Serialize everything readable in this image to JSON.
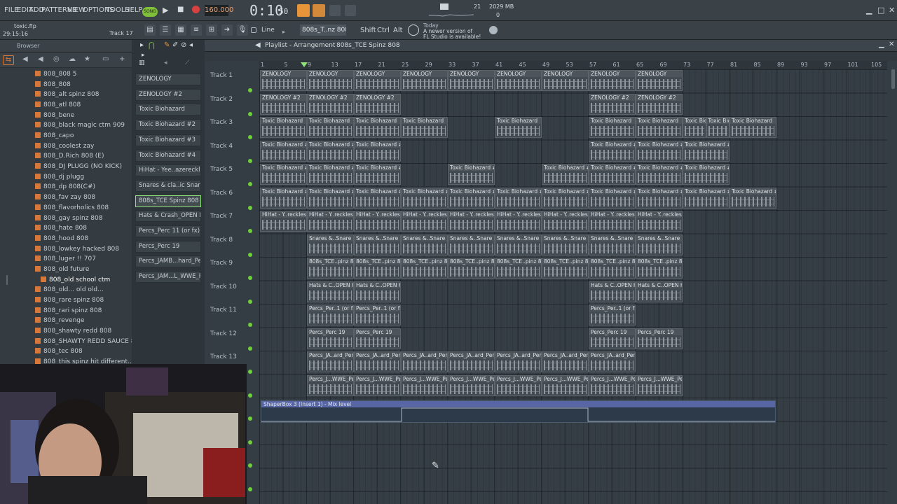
{
  "menu": [
    "FILE",
    "EDIT",
    "ADD",
    "PATTERNS",
    "VIEW",
    "OPTIONS",
    "TOOLS",
    "HELP"
  ],
  "transport": {
    "mode": "SONG",
    "tempo": "160.000",
    "time": "0:10",
    "time_frac": "50",
    "cpu": "21",
    "ram": "2029 MB",
    "ram_sub": "0"
  },
  "project": {
    "file": "toxic.flp",
    "elapsed": "29:15:16",
    "track_hint": "Track 17"
  },
  "toolbar2": {
    "snap": "Line",
    "pattern": "808s_T..nz 808",
    "shift": "Shift",
    "ctrl": "Ctrl",
    "alt": "Alt"
  },
  "news": {
    "when": "Today",
    "line1": "A newer version of",
    "line2": "FL Studio is available!"
  },
  "browser": {
    "title": "Browser",
    "items": [
      "808_808 5",
      "808_808",
      "808_alt spinz 808",
      "808_atl 808",
      "808_bene",
      "808_black magic ctm 909",
      "808_capo",
      "808_coolest zay",
      "808_D.Rich 808 (E)",
      "808_DJ PLUGG (NO KICK)",
      "808_dj plugg",
      "808_dp 808(C#)",
      "808_fav zay 808",
      "808_flavorholics 808",
      "808_gay spinz 808",
      "808_hate 808",
      "808_hood 808",
      "808_lowkey hacked 808",
      "808_luger !! 707",
      "808_old future",
      "808_old school ctm",
      "808_old... old old...",
      "808_rare spinz 808",
      "808_rari spinz 808",
      "808_revenge",
      "808_shawty redd 808",
      "808_SHAWTY REDD SAUCE 808",
      "808_tec 808",
      "808_this spinz hit different..."
    ]
  },
  "channels": [
    "ZENOLOGY",
    "ZENOLOGY #2",
    "Toxic Biohazard",
    "Toxic Biohazard #2",
    "Toxic Biohazard #3",
    "Toxic Biohazard #4",
    "HiHat - Yee..azereckless",
    "Snares & cla..ic Snare (8)",
    "808s_TCE Spinz 808",
    "Hats & Crash_OPEN HAT",
    "Percs_Perc 11 (or fx)",
    "Percs_Perc 19",
    "Percs_JAMB...hard_Perc",
    "Percs_JAM...L_WWE_Perc"
  ],
  "playlist": {
    "title": "Playlist - Arrangement",
    "pattern": "808s_TCE Spinz 808",
    "ruler": [
      "1",
      "5",
      "9",
      "13",
      "17",
      "21",
      "25",
      "29",
      "33",
      "37",
      "41",
      "45",
      "49",
      "53",
      "57",
      "61",
      "65",
      "69",
      "73",
      "77",
      "81",
      "85",
      "89",
      "93",
      "97",
      "101",
      "105"
    ],
    "tracks": [
      "Track 1",
      "Track 2",
      "Track 3",
      "Track 4",
      "Track 5",
      "Track 6",
      "Track 7",
      "Track 8",
      "Track 9",
      "Track 10",
      "Track 11",
      "Track 12",
      "Track 13"
    ],
    "automation_label": "ShaperBox 3 (Insert 1) - Mix level",
    "clip_labels": {
      "t1": "ZENOLOGY",
      "t2": "ZENOLOGY #2",
      "t3": "Toxic Biohazard",
      "t4": "Toxic Biohazard #2",
      "t5": "Toxic Biohazard #3",
      "t6": "Toxic Biohazard #4",
      "t7": "HiHat - Y..reckless",
      "t8": "Snares &..Snare (8)",
      "t9": "808s_TCE..pinz 808",
      "t10": "Hats & C..OPEN HAT",
      "t11": "Percs_Per..1 (or fx)",
      "t12": "Percs_Perc 19",
      "t13": "Percs_JA..ard_Perc",
      "t14": "Percs_J...WWE_Perc"
    }
  }
}
